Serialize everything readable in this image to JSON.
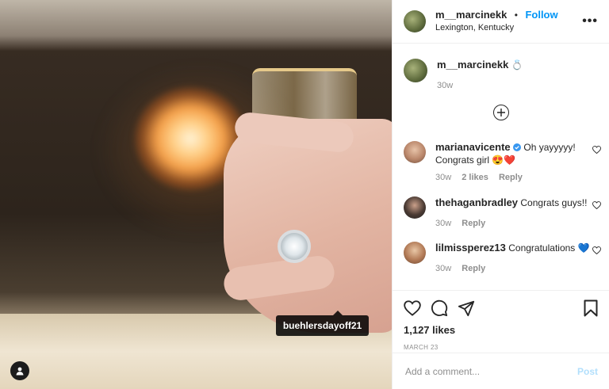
{
  "post": {
    "username": "m__marcinekk",
    "dot": "•",
    "follow_label": "Follow",
    "location": "Lexington, Kentucky",
    "more_label": "•••",
    "photo_tag": "buehlersdayoff21",
    "caption": {
      "username": "m__marcinekk",
      "emoji": "💍",
      "time": "30w"
    },
    "likes": "1,127 likes",
    "date": "MARCH 23"
  },
  "comments": [
    {
      "username": "marianavicente",
      "verified": true,
      "text": "Oh yayyyyy! Congrats girl 😍❤️",
      "time": "30w",
      "likes": "2 likes",
      "reply": "Reply"
    },
    {
      "username": "thehaganbradley",
      "verified": false,
      "text": "Congrats guys!!",
      "time": "30w",
      "reply": "Reply"
    },
    {
      "username": "lilmissperez13",
      "verified": false,
      "text": "Congratulations 💙",
      "time": "30w",
      "reply": "Reply"
    }
  ],
  "composer": {
    "placeholder": "Add a comment...",
    "post_label": "Post"
  },
  "colors": {
    "link_blue": "#0095f6",
    "post_disabled": "#b2dffc",
    "muted": "#8e8e8e"
  }
}
